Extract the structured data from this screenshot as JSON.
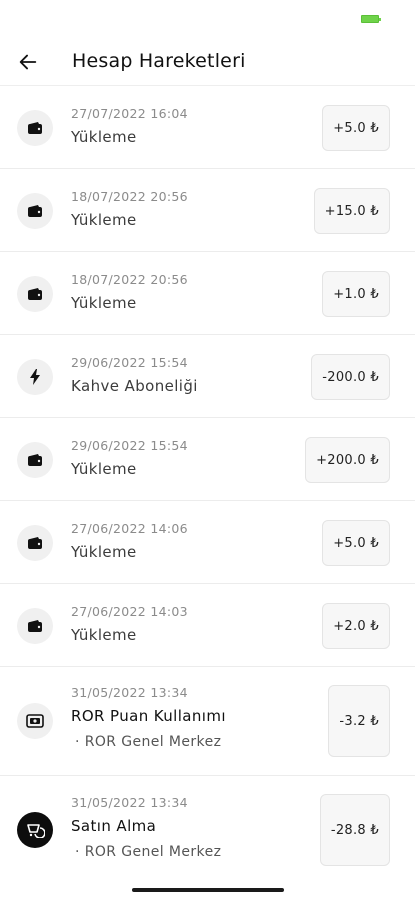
{
  "colors": {
    "battery": "#6fd34a",
    "avatar_bg": "#f0f0f0",
    "avatar_dark_bg": "#0d0d0d",
    "amount_bg": "#f7f7f7"
  },
  "header": {
    "title": "Hesap Hareketleri",
    "back_icon": "arrow-left-icon"
  },
  "transactions": [
    {
      "date": "27/07/2022 16:04",
      "title": "Yükleme",
      "amount": "+5.0 ₺",
      "icon": "wallet-icon"
    },
    {
      "date": "18/07/2022 20:56",
      "title": "Yükleme",
      "amount": "+15.0 ₺",
      "icon": "wallet-icon"
    },
    {
      "date": "18/07/2022 20:56",
      "title": "Yükleme",
      "amount": "+1.0 ₺",
      "icon": "wallet-icon"
    },
    {
      "date": "29/06/2022 15:54",
      "title": "Kahve Aboneliği",
      "amount": "-200.0 ₺",
      "icon": "lightning-icon"
    },
    {
      "date": "29/06/2022 15:54",
      "title": "Yükleme",
      "amount": "+200.0 ₺",
      "icon": "wallet-icon"
    },
    {
      "date": "27/06/2022 14:06",
      "title": "Yükleme",
      "amount": "+5.0 ₺",
      "icon": "wallet-icon"
    },
    {
      "date": "27/06/2022 14:03",
      "title": "Yükleme",
      "amount": "+2.0 ₺",
      "icon": "wallet-icon"
    },
    {
      "date": "31/05/2022 13:34",
      "title": "ROR Puan Kullanımı",
      "subtitle": "· ROR Genel Merkez",
      "amount": "-3.2 ₺",
      "icon": "points-icon"
    },
    {
      "date": "31/05/2022 13:34",
      "title": "Satın Alma",
      "subtitle": "· ROR Genel Merkez",
      "amount": "-28.8 ₺",
      "icon": "purchase-icon"
    }
  ]
}
